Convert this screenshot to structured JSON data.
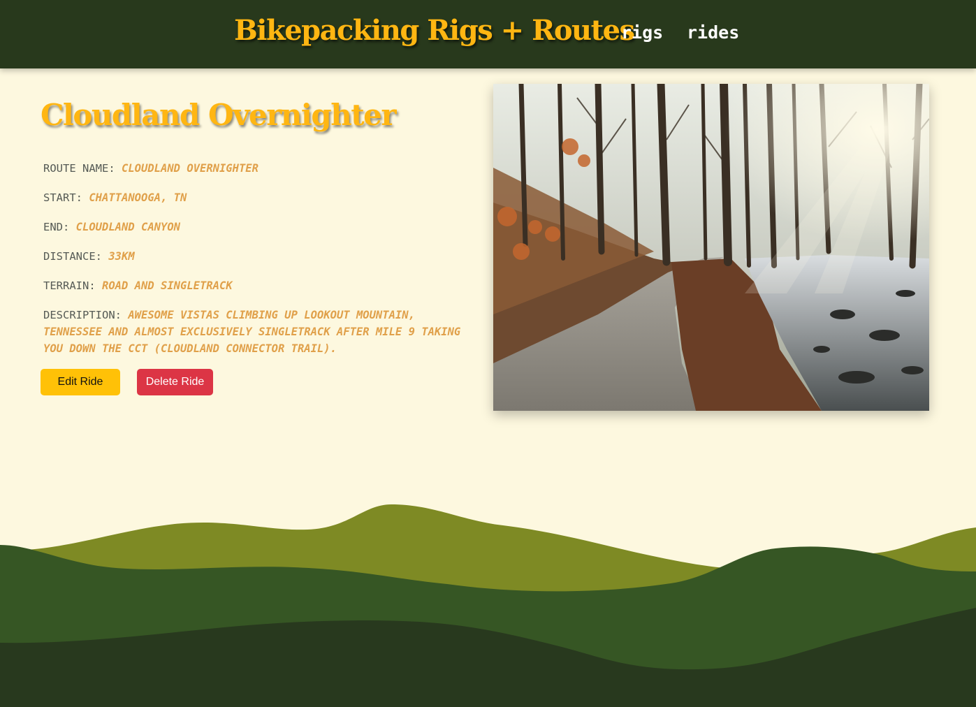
{
  "nav": {
    "brand": "Bikepacking Rigs + Routes",
    "links": [
      "rigs",
      "rides"
    ]
  },
  "ride": {
    "title": "Cloudland Overnighter",
    "fields": [
      {
        "label": "Route Name:",
        "value": "Cloudland Overnighter"
      },
      {
        "label": "Start:",
        "value": "Chattanooga, TN"
      },
      {
        "label": "End:",
        "value": "Cloudland Canyon"
      },
      {
        "label": "Distance:",
        "value": "33km"
      },
      {
        "label": "Terrain:",
        "value": "road and singletrack"
      },
      {
        "label": "Description:",
        "value": "Awesome vistas climbing up Lookout Mountain, Tennessee and almost exclusively singletrack after mile 9 taking you down the CCT (Cloudland Connector Trail)."
      }
    ],
    "photo_icon": "forest-gravel-road-photo"
  },
  "buttons": {
    "edit": "Edit Ride",
    "delete": "Delete Ride"
  },
  "colors": {
    "navbar": "#28391c",
    "brand": "#ffb612",
    "background": "#fdf8df",
    "value_text": "#e0a04a",
    "edit_button": "#ffc107",
    "delete_button": "#dc3545",
    "hill_light": "#7e8a24",
    "hill_mid": "#365624",
    "hill_dark": "#28391e"
  }
}
